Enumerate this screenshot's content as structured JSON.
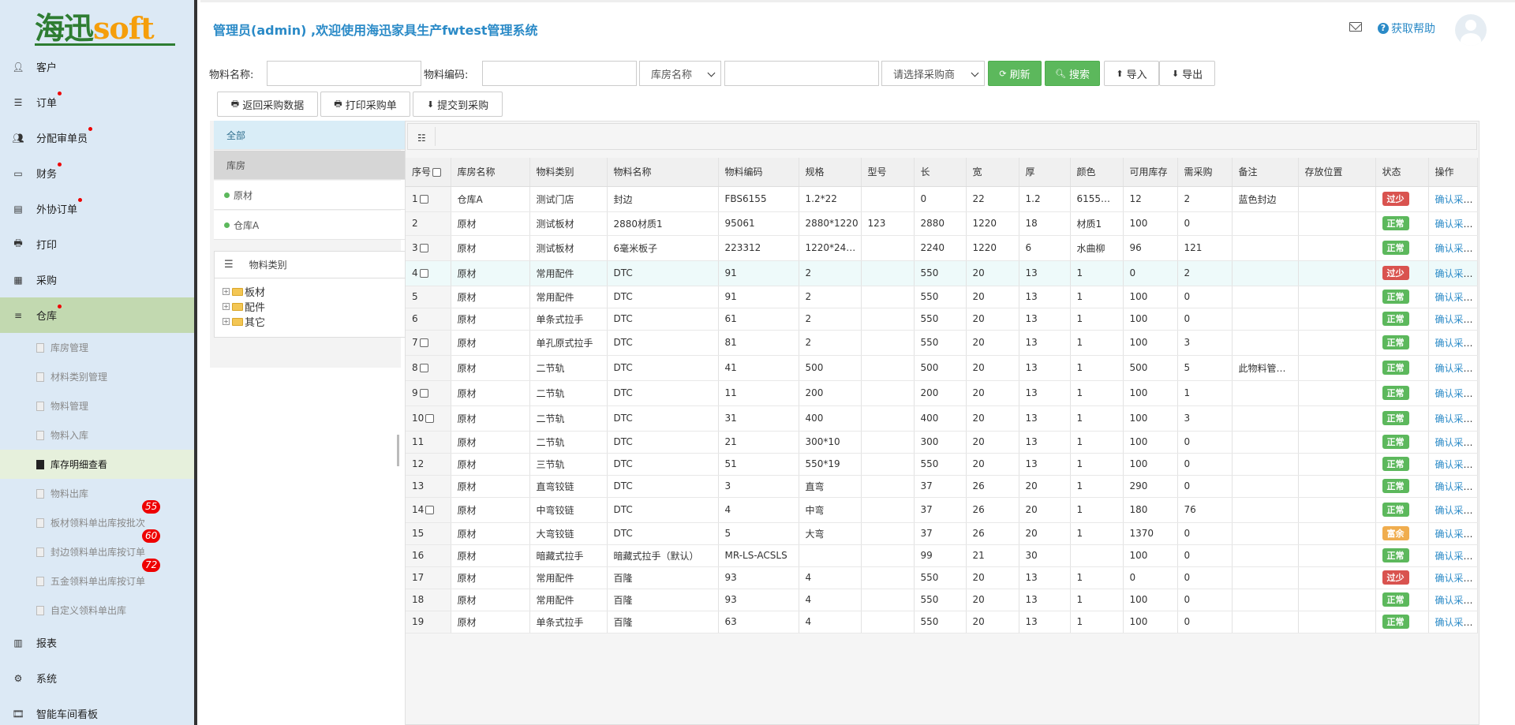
{
  "sidebar": {
    "logo_cn": "海迅",
    "logo_en": "soft",
    "items": [
      {
        "label": "客户",
        "icon": "user-icon",
        "dot": false
      },
      {
        "label": "订单",
        "icon": "list-icon",
        "dot": true
      },
      {
        "label": "分配审单员",
        "icon": "users-icon",
        "dot": true
      },
      {
        "label": "财务",
        "icon": "credit-card-icon",
        "dot": true
      },
      {
        "label": "外协订单",
        "icon": "form-icon",
        "dot": true
      },
      {
        "label": "打印",
        "icon": "print-icon",
        "dot": false
      },
      {
        "label": "采购",
        "icon": "grid-icon",
        "dot": false
      },
      {
        "label": "仓库",
        "icon": "bars-icon",
        "dot": true
      },
      {
        "label": "报表",
        "icon": "bar-chart-icon",
        "dot": false
      },
      {
        "label": "系统",
        "icon": "gear-icon",
        "dot": false
      },
      {
        "label": "智能车间看板",
        "icon": "film-icon",
        "dot": false
      }
    ],
    "sub_items": [
      {
        "label": "库房管理",
        "badge": ""
      },
      {
        "label": "材料类别管理",
        "badge": ""
      },
      {
        "label": "物料管理",
        "badge": ""
      },
      {
        "label": "物料入库",
        "badge": ""
      },
      {
        "label": "库存明细查看",
        "badge": ""
      },
      {
        "label": "物料出库",
        "badge": ""
      },
      {
        "label": "板材领料单出库按批次",
        "badge": "55"
      },
      {
        "label": "封边领料单出库按订单",
        "badge": "60"
      },
      {
        "label": "五金领料单出库按订单",
        "badge": "72"
      },
      {
        "label": "自定义领料单出库",
        "badge": ""
      }
    ]
  },
  "header": {
    "title": "管理员(admin) ,欢迎使用海迅家具生产fwtest管理系统",
    "help": "获取帮助"
  },
  "filters": {
    "material_name_label": "物料名称:",
    "material_code_label": "物料编码:",
    "warehouse_select": "库房名称",
    "supplier_select": "请选择采购商",
    "material_name_value": "",
    "material_code_value": "",
    "extra_value": ""
  },
  "buttons": {
    "refresh": "刷新",
    "search": "搜索",
    "import": "导入",
    "export": "导出",
    "return_purchase": "返回采购数据",
    "print_order": "打印采购单",
    "submit_purchase": "提交到采购"
  },
  "left_panel": {
    "all": "全部",
    "warehouse_head": "库房",
    "warehouses": [
      "原材",
      "仓库A"
    ],
    "category_head": "物料类别",
    "tree": [
      "板材",
      "配件",
      "其它"
    ]
  },
  "table": {
    "columns": [
      "序号",
      "库房名称",
      "物料类别",
      "物料名称",
      "物料编码",
      "规格",
      "型号",
      "长",
      "宽",
      "厚",
      "颜色",
      "可用库存",
      "需采购",
      "备注",
      "存放位置",
      "状态",
      "操作"
    ],
    "op_label": "确认采购量",
    "rows": [
      {
        "seq": "1",
        "cb": true,
        "cells": [
          "仓库A",
          "测试门店",
          "封边",
          "FBS6155",
          "1.2*22",
          "",
          "0",
          "22",
          "1.2",
          "6155…",
          "12",
          "2",
          "蓝色封边",
          ""
        ],
        "status": "过少",
        "st": "low"
      },
      {
        "seq": "2",
        "cb": false,
        "cells": [
          "原材",
          "测试板材",
          "2880材质1",
          "95061",
          "2880*1220",
          "123",
          "2880",
          "1220",
          "18",
          "材质1",
          "100",
          "0",
          "",
          ""
        ],
        "status": "正常",
        "st": "ok"
      },
      {
        "seq": "3",
        "cb": true,
        "cells": [
          "原材",
          "测试板材",
          "6毫米板子",
          "223312",
          "1220*24…",
          "",
          "2240",
          "1220",
          "6",
          "水曲柳",
          "96",
          "121",
          "",
          ""
        ],
        "status": "正常",
        "st": "ok"
      },
      {
        "seq": "4",
        "cb": true,
        "cells": [
          "原材",
          "常用配件",
          "DTC",
          "91",
          "2",
          "",
          "550",
          "20",
          "13",
          "1",
          "0",
          "2",
          "",
          ""
        ],
        "status": "过少",
        "st": "low"
      },
      {
        "seq": "5",
        "cb": false,
        "cells": [
          "原材",
          "常用配件",
          "DTC",
          "91",
          "2",
          "",
          "550",
          "20",
          "13",
          "1",
          "100",
          "0",
          "",
          ""
        ],
        "status": "正常",
        "st": "ok"
      },
      {
        "seq": "6",
        "cb": false,
        "cells": [
          "原材",
          "单条式拉手",
          "DTC",
          "61",
          "2",
          "",
          "550",
          "20",
          "13",
          "1",
          "100",
          "0",
          "",
          ""
        ],
        "status": "正常",
        "st": "ok"
      },
      {
        "seq": "7",
        "cb": true,
        "cells": [
          "原材",
          "单孔原式拉手",
          "DTC",
          "81",
          "2",
          "",
          "550",
          "20",
          "13",
          "1",
          "100",
          "3",
          "",
          ""
        ],
        "status": "正常",
        "st": "ok"
      },
      {
        "seq": "8",
        "cb": true,
        "cells": [
          "原材",
          "二节轨",
          "DTC",
          "41",
          "500",
          "",
          "500",
          "20",
          "13",
          "1",
          "500",
          "5",
          "此物料管…",
          ""
        ],
        "status": "正常",
        "st": "ok"
      },
      {
        "seq": "9",
        "cb": true,
        "cells": [
          "原材",
          "二节轨",
          "DTC",
          "11",
          "200",
          "",
          "200",
          "20",
          "13",
          "1",
          "100",
          "1",
          "",
          ""
        ],
        "status": "正常",
        "st": "ok"
      },
      {
        "seq": "10",
        "cb": true,
        "cells": [
          "原材",
          "二节轨",
          "DTC",
          "31",
          "400",
          "",
          "400",
          "20",
          "13",
          "1",
          "100",
          "3",
          "",
          ""
        ],
        "status": "正常",
        "st": "ok"
      },
      {
        "seq": "11",
        "cb": false,
        "cells": [
          "原材",
          "二节轨",
          "DTC",
          "21",
          "300*10",
          "",
          "300",
          "20",
          "13",
          "1",
          "100",
          "0",
          "",
          ""
        ],
        "status": "正常",
        "st": "ok"
      },
      {
        "seq": "12",
        "cb": false,
        "cells": [
          "原材",
          "三节轨",
          "DTC",
          "51",
          "550*19",
          "",
          "550",
          "20",
          "13",
          "1",
          "100",
          "0",
          "",
          ""
        ],
        "status": "正常",
        "st": "ok"
      },
      {
        "seq": "13",
        "cb": false,
        "cells": [
          "原材",
          "直弯铰链",
          "DTC",
          "3",
          "直弯",
          "",
          "37",
          "26",
          "20",
          "1",
          "290",
          "0",
          "",
          ""
        ],
        "status": "正常",
        "st": "ok"
      },
      {
        "seq": "14",
        "cb": true,
        "cells": [
          "原材",
          "中弯铰链",
          "DTC",
          "4",
          "中弯",
          "",
          "37",
          "26",
          "20",
          "1",
          "180",
          "76",
          "",
          ""
        ],
        "status": "正常",
        "st": "ok"
      },
      {
        "seq": "15",
        "cb": false,
        "cells": [
          "原材",
          "大弯铰链",
          "DTC",
          "5",
          "大弯",
          "",
          "37",
          "26",
          "20",
          "1",
          "1370",
          "0",
          "",
          ""
        ],
        "status": "富余",
        "st": "rich"
      },
      {
        "seq": "16",
        "cb": false,
        "cells": [
          "原材",
          "暗藏式拉手",
          "暗藏式拉手（默认）",
          "MR-LS-ACSLS",
          "",
          "",
          "99",
          "21",
          "30",
          "",
          "100",
          "0",
          "",
          ""
        ],
        "status": "正常",
        "st": "ok"
      },
      {
        "seq": "17",
        "cb": false,
        "cells": [
          "原材",
          "常用配件",
          "百隆",
          "93",
          "4",
          "",
          "550",
          "20",
          "13",
          "1",
          "0",
          "0",
          "",
          ""
        ],
        "status": "过少",
        "st": "low"
      },
      {
        "seq": "18",
        "cb": false,
        "cells": [
          "原材",
          "常用配件",
          "百隆",
          "93",
          "4",
          "",
          "550",
          "20",
          "13",
          "1",
          "100",
          "0",
          "",
          ""
        ],
        "status": "正常",
        "st": "ok"
      },
      {
        "seq": "19",
        "cb": false,
        "cells": [
          "原材",
          "单条式拉手",
          "百隆",
          "63",
          "4",
          "",
          "550",
          "20",
          "13",
          "1",
          "100",
          "0",
          "",
          ""
        ],
        "status": "正常",
        "st": "ok"
      }
    ]
  }
}
